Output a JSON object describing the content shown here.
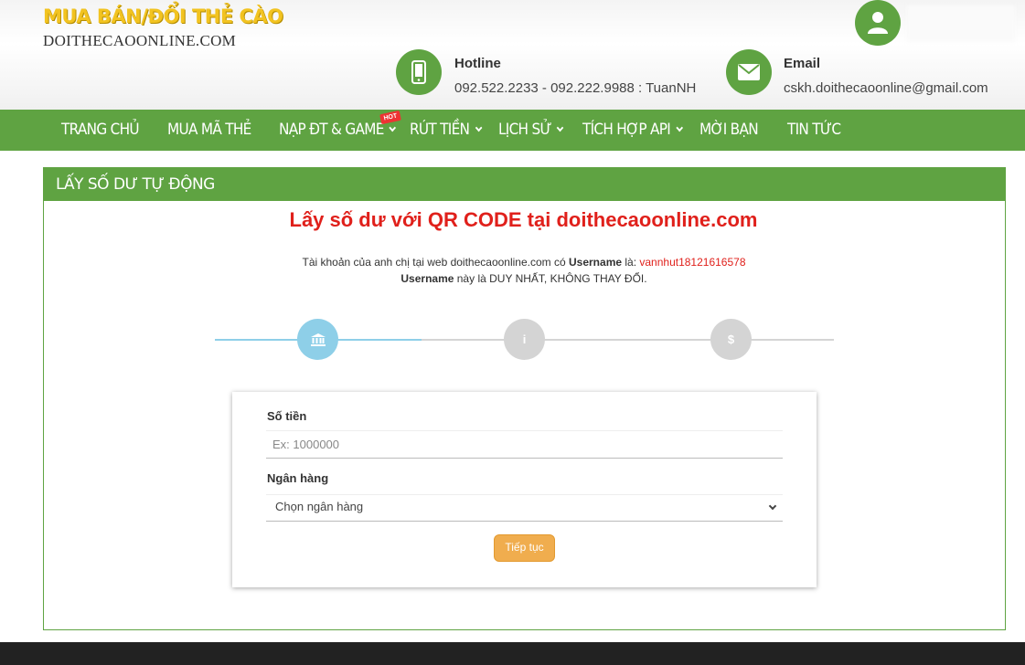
{
  "header": {
    "logo_line1": "MUA BÁN/ĐỔI THẺ CÀO",
    "logo_line2": "DOITHECAOONLINE.COM",
    "hotline": {
      "title": "Hotline",
      "value": "092.522.2233 - 092.222.9988 : TuanNH",
      "icon": "phone-icon"
    },
    "email": {
      "title": "Email",
      "value": "cskh.doithecaoonline@gmail.com",
      "icon": "envelope-icon"
    },
    "user": {
      "icon": "user-icon"
    }
  },
  "nav": {
    "items": [
      {
        "label": "TRANG CHỦ",
        "dropdown": false
      },
      {
        "label": "MUA MÃ THẺ",
        "dropdown": false
      },
      {
        "label": "NẠP ĐT & GAME",
        "dropdown": true
      },
      {
        "label": "RÚT TIỀN",
        "dropdown": true
      },
      {
        "label": "LỊCH SỬ",
        "dropdown": true
      },
      {
        "label": "TÍCH HỢP API",
        "dropdown": true
      },
      {
        "label": "MỜI BẠN",
        "dropdown": false
      },
      {
        "label": "TIN TỨC",
        "dropdown": false
      }
    ],
    "hot_badge": "HOT"
  },
  "panel": {
    "title": "LẤY SỐ DƯ TỰ ĐỘNG",
    "qr_title": "Lấy số dư với QR CODE tại doithecaoonline.com",
    "info1_prefix": "Tài khoản của anh chị tại web doithecaoonline.com có ",
    "info1_bold": "Username",
    "info1_mid": " là: ",
    "username": "vannhut18121616578",
    "info2_bold": "Username",
    "info2_rest": " này là DUY NHẤT, KHÔNG THAY ĐỔI.",
    "steps": [
      {
        "icon": "bank-icon",
        "glyph": "🏛",
        "active": true
      },
      {
        "icon": "info-icon",
        "glyph": "i",
        "active": false
      },
      {
        "icon": "dollar-icon",
        "glyph": "$",
        "active": false
      }
    ]
  },
  "form": {
    "amount_label": "Số tiền",
    "amount_placeholder": "Ex: 1000000",
    "amount_value": "",
    "bank_label": "Ngân hàng",
    "bank_selected": "Chọn ngân hàng",
    "submit_label": "Tiếp tục"
  },
  "colors": {
    "brand_green": "#5fa342",
    "accent_red": "#e0201b",
    "step_active": "#8ecfe8",
    "step_inactive": "#d4d4d4",
    "button_orange": "#f0ad4e",
    "logo_yellow": "#f2c320"
  }
}
